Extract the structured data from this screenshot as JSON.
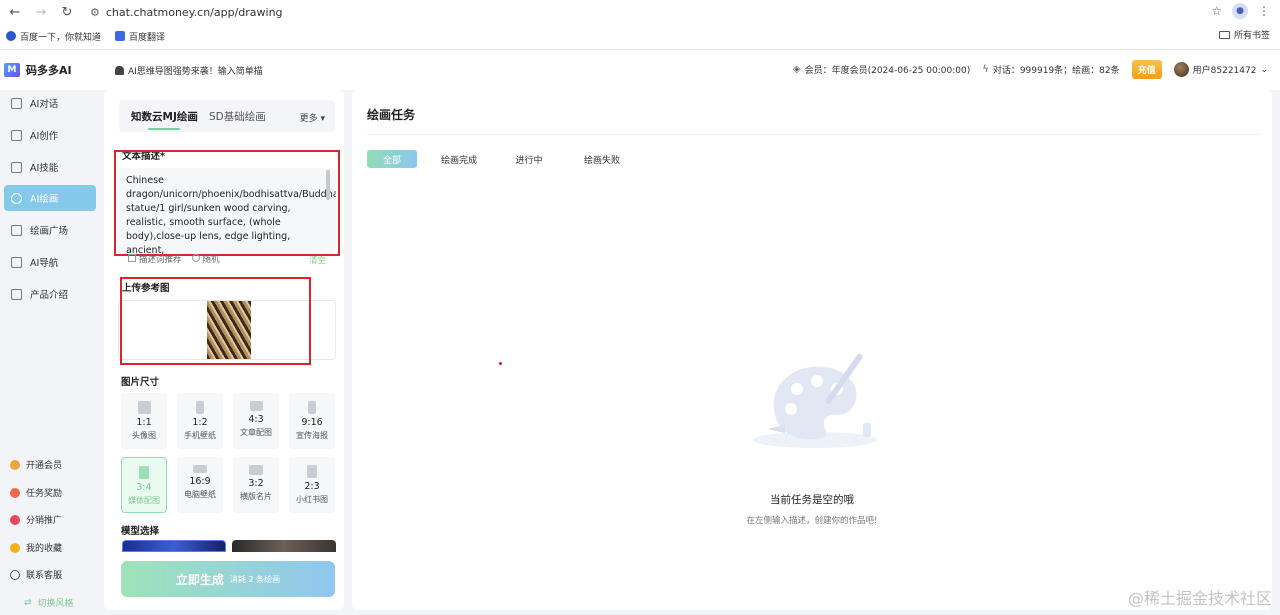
{
  "browser": {
    "url": "chat.chatmoney.cn/app/drawing",
    "bookmarks": [
      "百度一下，你就知道",
      "百度翻译"
    ],
    "all_bookmarks": "所有书签"
  },
  "header": {
    "brand": "码多多AI",
    "notice": "AI思维导图强势来袭！输入简单描",
    "membership": "会员：年度会员(2024-06-25 00:00:00)",
    "usage": "对话：999919条；绘画：82条",
    "recharge": "充值",
    "username": "用户85221472"
  },
  "sidebar": {
    "items": [
      {
        "label": "AI对话"
      },
      {
        "label": "AI创作"
      },
      {
        "label": "AI技能"
      },
      {
        "label": "AI绘画"
      },
      {
        "label": "绘画广场"
      },
      {
        "label": "AI导航"
      },
      {
        "label": "产品介绍"
      }
    ],
    "bottom": [
      {
        "label": "开通会员",
        "color": "#f0a53a"
      },
      {
        "label": "任务奖励",
        "color": "#ef6a4b"
      },
      {
        "label": "分销推广",
        "color": "#e6495a"
      },
      {
        "label": "我的收藏",
        "color": "#f3b11d"
      },
      {
        "label": "联系客服",
        "color": "#555555"
      }
    ],
    "switch_style": "切换风格"
  },
  "left_panel": {
    "tabs": [
      "知数云MJ绘画",
      "SD基础绘画"
    ],
    "more": "更多",
    "prompt_label": "文本描述*",
    "prompt_text": "Chinese dragon/unicorn/phoenix/bodhisattva/Buddha statue/1 girl/sunken wood carving, realistic, smooth surface, (whole body),close-up lens, edge lighting, ancient, ",
    "prompt_recommend": "描述词推荐",
    "random": "随机",
    "clear": "清空",
    "upload_label": "上传参考图",
    "size_label": "图片尺寸",
    "sizes": [
      {
        "ratio": "1:1",
        "name": "头像图"
      },
      {
        "ratio": "1:2",
        "name": "手机壁纸"
      },
      {
        "ratio": "4:3",
        "name": "文章配图"
      },
      {
        "ratio": "9:16",
        "name": "宣传海报"
      },
      {
        "ratio": "3:4",
        "name": "媒体配图"
      },
      {
        "ratio": "16:9",
        "name": "电脑壁纸"
      },
      {
        "ratio": "3:2",
        "name": "横版名片"
      },
      {
        "ratio": "2:3",
        "name": "小红书图"
      }
    ],
    "selected_size": "3:4",
    "model_label": "模型选择",
    "generate": "立即生成",
    "generate_cost": "消耗 2 条绘画"
  },
  "main": {
    "title": "绘画任务",
    "status_tabs": [
      "全部",
      "绘画完成",
      "进行中",
      "绘画失败"
    ],
    "empty_title": "当前任务是空的哦",
    "empty_sub": "在左侧输入描述，创建你的作品吧!"
  },
  "watermark": "@稀土掘金技术社区"
}
